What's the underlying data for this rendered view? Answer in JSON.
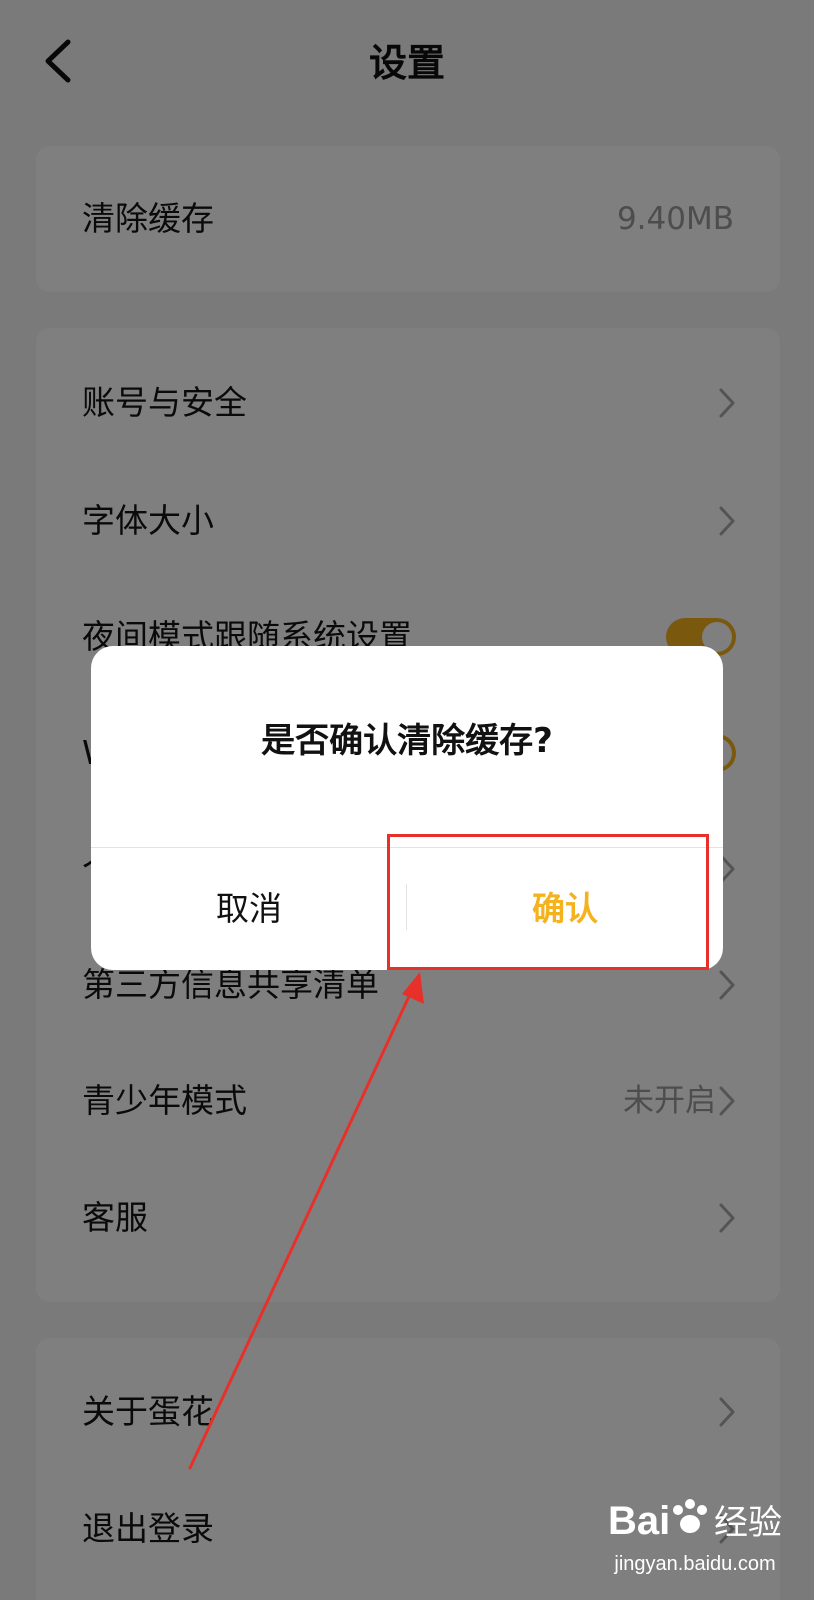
{
  "header": {
    "title": "设置"
  },
  "cache_card": {
    "label": "清除缓存",
    "value": "9.40MB"
  },
  "settings": {
    "items": [
      {
        "label": "账号与安全"
      },
      {
        "label": "字体大小"
      },
      {
        "label": "夜间模式跟随系统设置",
        "toggle_on": true
      },
      {
        "label": "W",
        "toggle_on": true
      },
      {
        "label": "个"
      },
      {
        "label": "第三方信息共享清单"
      },
      {
        "label": "青少年模式",
        "value": "未开启"
      },
      {
        "label": "客服"
      }
    ]
  },
  "bottom_card": {
    "items": [
      {
        "label": "关于蛋花"
      },
      {
        "label": "退出登录"
      }
    ]
  },
  "dialog": {
    "title": "是否确认清除缓存?",
    "cancel_label": "取消",
    "confirm_label": "确认"
  },
  "watermark": {
    "logo_text": "Bai 经验",
    "url": "jingyan.baidu.com"
  },
  "colors": {
    "accent": "#f4b31e",
    "annotation": "#e8302a",
    "background": "#f5f5f5"
  },
  "icons": {
    "back": "chevron-left-icon",
    "row_arrow": "chevron-right-icon",
    "watermark": "paw-icon"
  }
}
